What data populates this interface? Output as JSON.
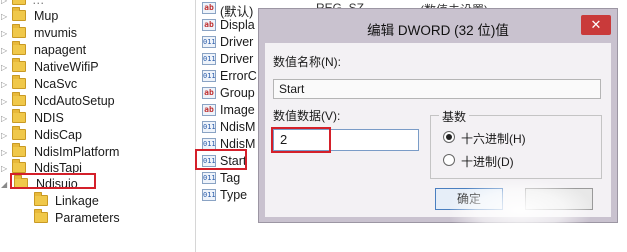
{
  "tree": {
    "items": [
      {
        "label": "Mup",
        "indent": 0
      },
      {
        "label": "mvumis",
        "indent": 0
      },
      {
        "label": "napagent",
        "indent": 0
      },
      {
        "label": "NativeWifiP",
        "indent": 0
      },
      {
        "label": "NcaSvc",
        "indent": 0
      },
      {
        "label": "NcdAutoSetup",
        "indent": 0
      },
      {
        "label": "NDIS",
        "indent": 0
      },
      {
        "label": "NdisCap",
        "indent": 0
      },
      {
        "label": "NdisImPlatform",
        "indent": 0
      },
      {
        "label": "NdisTapi",
        "indent": 0
      },
      {
        "label": "Ndisuio",
        "indent": 0
      },
      {
        "label": "Linkage",
        "indent": 1
      },
      {
        "label": "Parameters",
        "indent": 1
      }
    ],
    "selected": "Ndisuio"
  },
  "values": {
    "rows": [
      {
        "icon": "ab",
        "name": "(默认)",
        "type": "REG_SZ",
        "data": "(数值未设置)"
      },
      {
        "icon": "ab",
        "name": "Displa",
        "type": "",
        "data": ""
      },
      {
        "icon": "bin",
        "name": "Driver",
        "type": "",
        "data": ""
      },
      {
        "icon": "bin",
        "name": "Driver",
        "type": "",
        "data": ""
      },
      {
        "icon": "bin",
        "name": "ErrorC",
        "type": "",
        "data": ""
      },
      {
        "icon": "ab",
        "name": "Group",
        "type": "",
        "data": ""
      },
      {
        "icon": "ab",
        "name": "Image",
        "type": "",
        "data": ""
      },
      {
        "icon": "bin",
        "name": "NdisM",
        "type": "",
        "data": ""
      },
      {
        "icon": "bin",
        "name": "NdisM",
        "type": "",
        "data": ""
      },
      {
        "icon": "bin",
        "name": "Start",
        "type": "",
        "data": ""
      },
      {
        "icon": "bin",
        "name": "Tag",
        "type": "",
        "data": ""
      },
      {
        "icon": "bin",
        "name": "Type",
        "type": "",
        "data": ""
      }
    ],
    "highlighted": "Start"
  },
  "dialog": {
    "title": "编辑 DWORD (32 位)值",
    "close_glyph": "✕",
    "name_label": "数值名称(N):",
    "name_value": "Start",
    "data_label": "数值数据(V):",
    "data_value": "2",
    "base_label": "基数",
    "radio_hex": "十六进制(H)",
    "radio_dec": "十进制(D)",
    "base_selected": "hex",
    "ok_label": "确定",
    "cancel_label": ""
  },
  "colors": {
    "highlight_border": "#d4202a",
    "dialog_frame": "#c9c2cf",
    "close_button": "#c93a3a"
  }
}
